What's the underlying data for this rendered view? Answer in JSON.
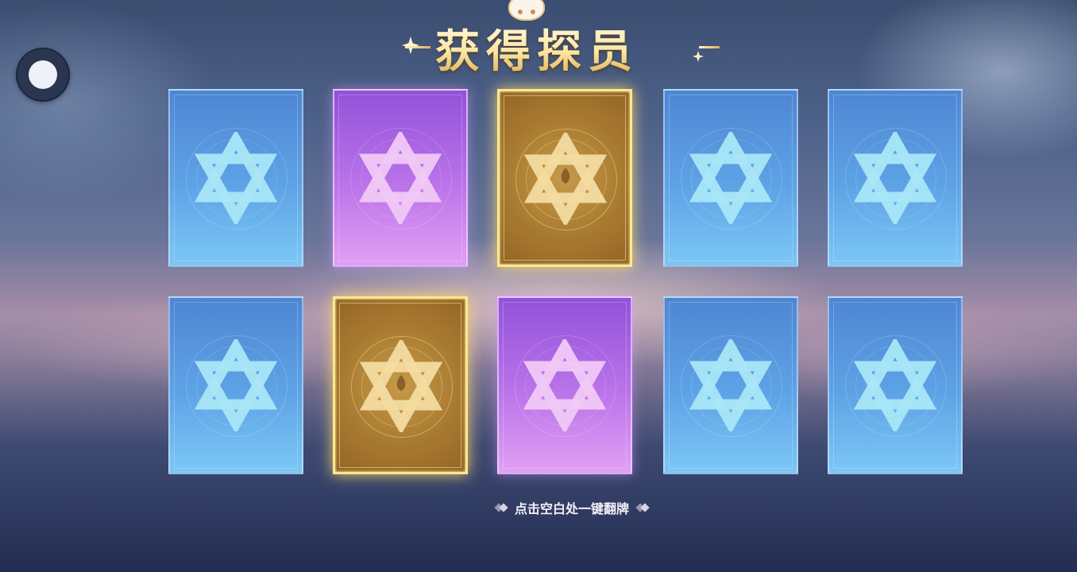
{
  "title": "获得探员",
  "hint": "点击空白处一键翻牌",
  "colors": {
    "blue_card": "#5ea3e6",
    "purple_card": "#bb74ea",
    "gold_card": "#c69a4a",
    "title_gold": "#fde7a0"
  },
  "cards": [
    {
      "rarity": "blue",
      "state": "face-down",
      "icon": "hexagram-emblem-icon"
    },
    {
      "rarity": "purple",
      "state": "face-down",
      "icon": "hexagram-emblem-icon"
    },
    {
      "rarity": "gold",
      "state": "face-down",
      "icon": "hexagram-flame-emblem-icon"
    },
    {
      "rarity": "blue",
      "state": "face-down",
      "icon": "hexagram-emblem-icon"
    },
    {
      "rarity": "blue",
      "state": "face-down",
      "icon": "hexagram-emblem-icon"
    },
    {
      "rarity": "blue",
      "state": "face-down",
      "icon": "hexagram-emblem-icon"
    },
    {
      "rarity": "gold",
      "state": "face-down",
      "icon": "hexagram-flame-emblem-icon"
    },
    {
      "rarity": "purple",
      "state": "face-down",
      "icon": "hexagram-emblem-icon"
    },
    {
      "rarity": "blue",
      "state": "face-down",
      "icon": "hexagram-emblem-icon"
    },
    {
      "rarity": "blue",
      "state": "face-down",
      "icon": "hexagram-emblem-icon"
    }
  ]
}
